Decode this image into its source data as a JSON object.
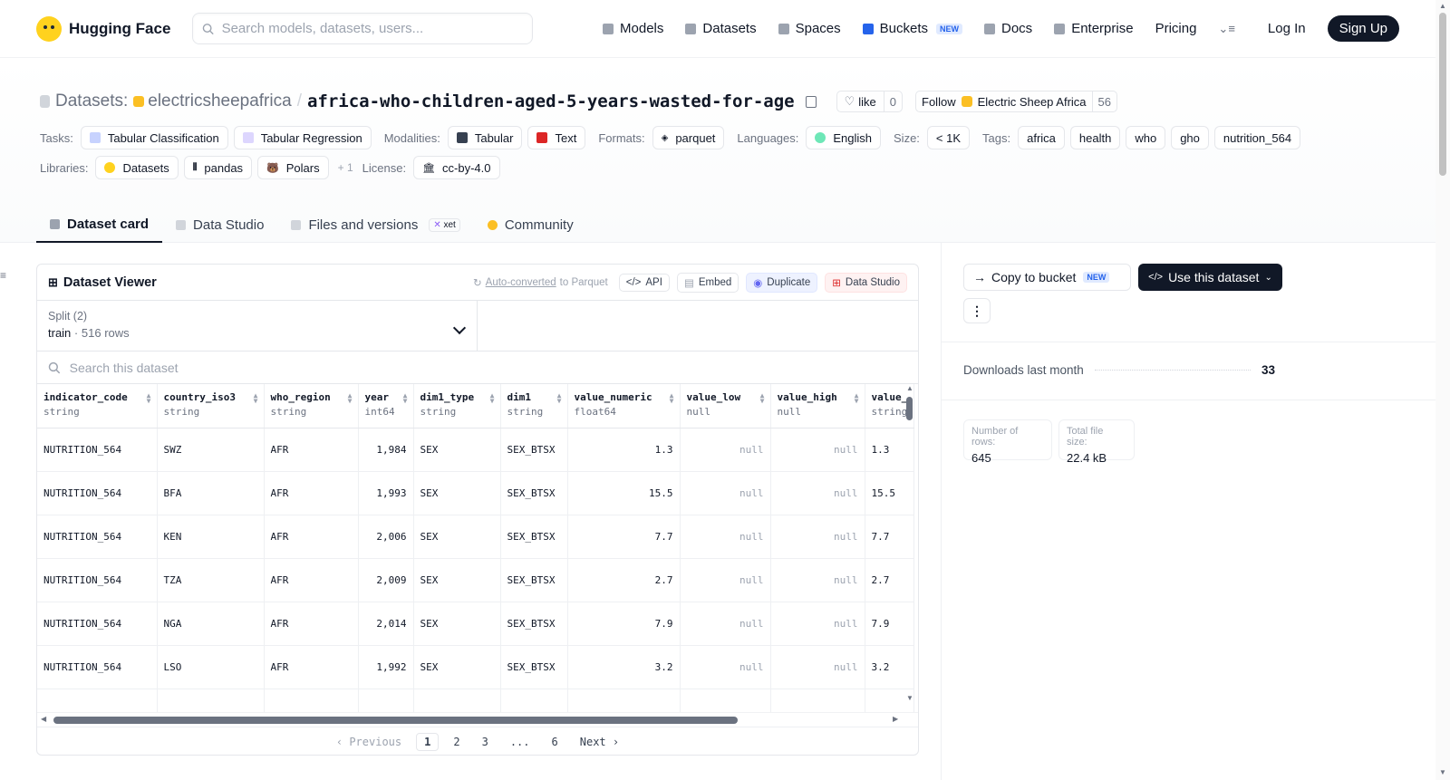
{
  "nav": {
    "brand": "Hugging Face",
    "search_placeholder": "Search models, datasets, users...",
    "links": [
      "Models",
      "Datasets",
      "Spaces",
      "Buckets",
      "Docs",
      "Enterprise",
      "Pricing"
    ],
    "buckets_badge": "NEW",
    "login": "Log In",
    "signup": "Sign Up"
  },
  "repo": {
    "type_label": "Datasets:",
    "org": "electricsheepafrica",
    "separator": "/",
    "name": "africa-who-children-aged-5-years-wasted-for-age",
    "like_label": "like",
    "like_count": "0",
    "follow_label": "Follow",
    "follow_org": "Electric Sheep Africa",
    "follow_count": "56"
  },
  "meta": {
    "tasks_label": "Tasks:",
    "tasks": [
      "Tabular Classification",
      "Tabular Regression"
    ],
    "modalities_label": "Modalities:",
    "modalities": [
      "Tabular",
      "Text"
    ],
    "formats_label": "Formats:",
    "formats": [
      "parquet"
    ],
    "languages_label": "Languages:",
    "languages": [
      "English"
    ],
    "size_label": "Size:",
    "size": "< 1K",
    "tags_label": "Tags:",
    "tags": [
      "africa",
      "health",
      "who",
      "gho",
      "nutrition_564"
    ],
    "libraries_label": "Libraries:",
    "libraries": [
      "Datasets",
      "pandas",
      "Polars"
    ],
    "libraries_more": "+ 1",
    "license_label": "License:",
    "license": "cc-by-4.0"
  },
  "tabs": [
    {
      "label": "Dataset card",
      "active": true
    },
    {
      "label": "Data Studio"
    },
    {
      "label": "Files and versions",
      "badge": "xet"
    },
    {
      "label": "Community"
    }
  ],
  "viewer": {
    "title": "Dataset Viewer",
    "auto_converted": "Auto-converted",
    "to_parquet": "to Parquet",
    "buttons": [
      "API",
      "Embed",
      "Duplicate",
      "Data Studio"
    ],
    "split_label": "Split (2)",
    "split_value": "train",
    "split_rows": "516 rows",
    "search_placeholder": "Search this dataset",
    "columns": [
      {
        "name": "indicator_code",
        "type": "string"
      },
      {
        "name": "country_iso3",
        "type": "string"
      },
      {
        "name": "who_region",
        "type": "string"
      },
      {
        "name": "year",
        "type": "int64"
      },
      {
        "name": "dim1_type",
        "type": "string"
      },
      {
        "name": "dim1",
        "type": "string"
      },
      {
        "name": "value_numeric",
        "type": "float64"
      },
      {
        "name": "value_low",
        "type": "null"
      },
      {
        "name": "value_high",
        "type": "null"
      },
      {
        "name": "value_",
        "type": "string"
      }
    ],
    "rows": [
      [
        "NUTRITION_564",
        "SWZ",
        "AFR",
        "1,984",
        "SEX",
        "SEX_BTSX",
        "1.3",
        "null",
        "null",
        "1.3"
      ],
      [
        "NUTRITION_564",
        "BFA",
        "AFR",
        "1,993",
        "SEX",
        "SEX_BTSX",
        "15.5",
        "null",
        "null",
        "15.5"
      ],
      [
        "NUTRITION_564",
        "KEN",
        "AFR",
        "2,006",
        "SEX",
        "SEX_BTSX",
        "7.7",
        "null",
        "null",
        "7.7"
      ],
      [
        "NUTRITION_564",
        "TZA",
        "AFR",
        "2,009",
        "SEX",
        "SEX_BTSX",
        "2.7",
        "null",
        "null",
        "2.7"
      ],
      [
        "NUTRITION_564",
        "NGA",
        "AFR",
        "2,014",
        "SEX",
        "SEX_BTSX",
        "7.9",
        "null",
        "null",
        "7.9"
      ],
      [
        "NUTRITION_564",
        "LSO",
        "AFR",
        "1,992",
        "SEX",
        "SEX_BTSX",
        "3.2",
        "null",
        "null",
        "3.2"
      ]
    ],
    "pager": {
      "prev": "Previous",
      "pages": [
        "1",
        "2",
        "3",
        "...",
        "6"
      ],
      "current": "1",
      "next": "Next"
    }
  },
  "sidebar": {
    "copy_bucket": "Copy to bucket",
    "copy_badge": "NEW",
    "use_dataset": "Use this dataset",
    "downloads_label": "Downloads last month",
    "downloads_value": "33",
    "rows_label": "Number of rows:",
    "rows_value": "645",
    "size_label": "Total file size:",
    "size_value": "22.4 kB"
  },
  "colors": {
    "accent": "#111827",
    "brand": "#FFD21E",
    "muted": "#6b7280"
  }
}
